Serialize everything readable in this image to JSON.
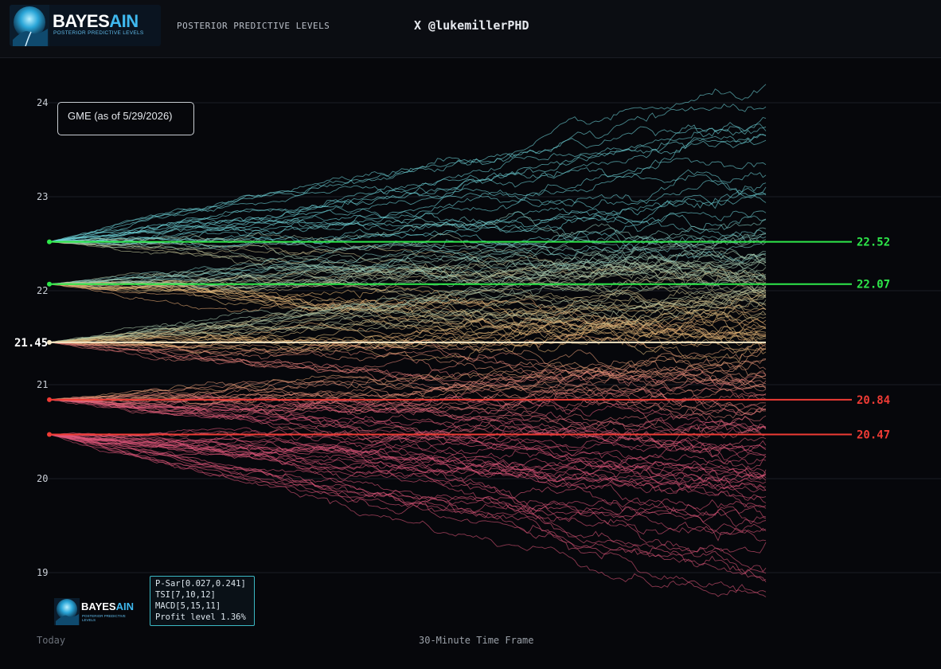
{
  "header": {
    "logo_name_main": "BAYES",
    "logo_name_accent": "AIN",
    "logo_tagline": "POSTERIOR PREDICTIVE LEVELS",
    "title": "POSTERIOR PREDICTIVE LEVELS",
    "handle": "X @lukemillerPHD"
  },
  "legend_label": "GME (as of 5/29/2026)",
  "info_box": {
    "lines": [
      "P-Sar[0.027,0.241]",
      "TSI[7,10,12]",
      "MACD[5,15,11]",
      "Profit level 1.36%"
    ]
  },
  "watermark": {
    "name_main": "BAYES",
    "name_accent": "AIN",
    "tagline": "POSTERIOR PREDICTIVE LEVELS"
  },
  "footer": {
    "x_left_label": "Today",
    "x_center_label": "30-Minute Time Frame"
  },
  "colors": {
    "background": "#06070b",
    "resistance": "#2ee84a",
    "support": "#ef3b35",
    "current": "#f3e6c4",
    "path_high": "#6fd6dc",
    "path_mid": "#e8b874",
    "path_low": "#e0577a",
    "accent": "#3fb8ee"
  },
  "chart_data": {
    "type": "line",
    "title": "",
    "xlabel": "30-Minute Time Frame",
    "ylabel": "",
    "ylim": [
      18.85,
      24.1
    ],
    "yticks": [
      19,
      20,
      21,
      22,
      23,
      24
    ],
    "current_price": 21.45,
    "current_label": "21.45",
    "levels": [
      {
        "value": 22.52,
        "label": "22.52",
        "kind": "resistance"
      },
      {
        "value": 22.07,
        "label": "22.07",
        "kind": "resistance"
      },
      {
        "value": 20.84,
        "label": "20.84",
        "kind": "support"
      },
      {
        "value": 20.47,
        "label": "20.47",
        "kind": "support"
      }
    ],
    "path_groups": [
      {
        "start": 22.52,
        "count": 30,
        "end_low": 21.8,
        "end_high": 24.0
      },
      {
        "start": 22.07,
        "count": 34,
        "end_low": 21.4,
        "end_high": 22.7
      },
      {
        "start": 21.45,
        "count": 36,
        "end_low": 20.7,
        "end_high": 22.3
      },
      {
        "start": 20.84,
        "count": 30,
        "end_low": 20.1,
        "end_high": 21.4
      },
      {
        "start": 20.47,
        "count": 30,
        "end_low": 18.75,
        "end_high": 20.7
      }
    ],
    "grid": true,
    "steps": 240
  }
}
